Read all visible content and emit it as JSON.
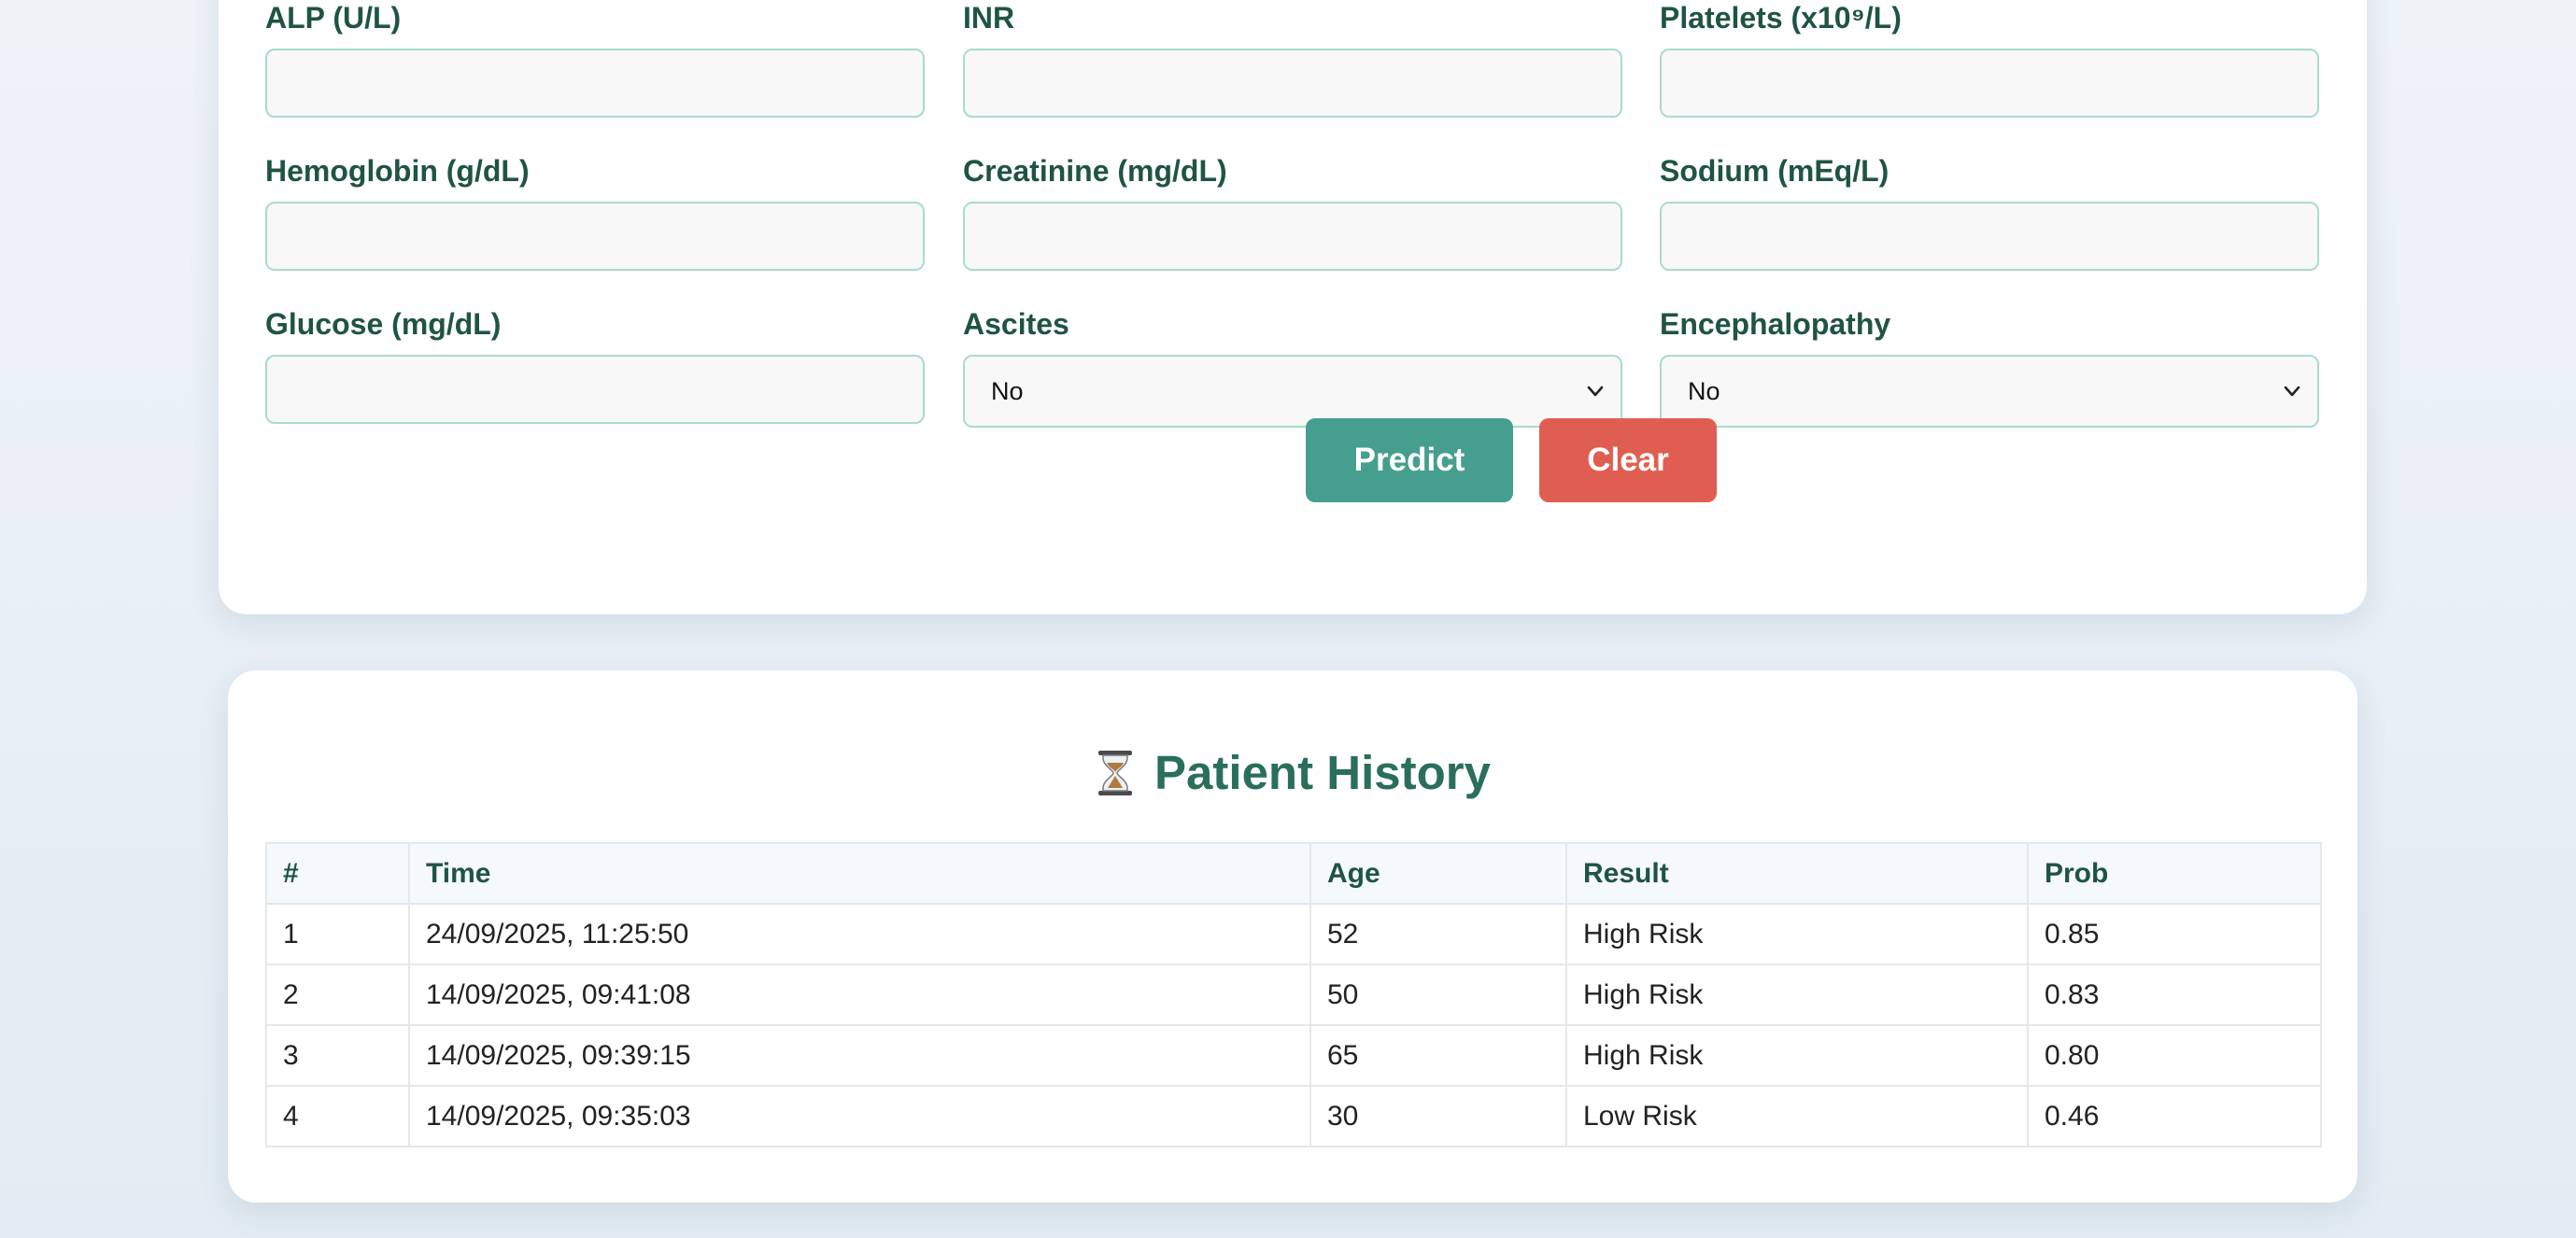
{
  "form": {
    "fields": [
      {
        "label": "ALP (U/L)",
        "value": ""
      },
      {
        "label": "INR",
        "value": ""
      },
      {
        "label": "Platelets (x10⁹/L)",
        "value": ""
      },
      {
        "label": "Hemoglobin (g/dL)",
        "value": ""
      },
      {
        "label": "Creatinine (mg/dL)",
        "value": ""
      },
      {
        "label": "Sodium (mEq/L)",
        "value": ""
      },
      {
        "label": "Glucose (mg/dL)",
        "value": ""
      }
    ],
    "selects": [
      {
        "label": "Ascites",
        "value": "No"
      },
      {
        "label": "Encephalopathy",
        "value": "No"
      }
    ],
    "predict_label": "Predict",
    "clear_label": "Clear"
  },
  "history": {
    "title": "Patient History",
    "icon": "hourglass-icon",
    "columns": [
      "#",
      "Time",
      "Age",
      "Result",
      "Prob"
    ],
    "rows": [
      {
        "num": "1",
        "time": "24/09/2025, 11:25:50",
        "age": "52",
        "result": "High Risk",
        "prob": "0.85"
      },
      {
        "num": "2",
        "time": "14/09/2025, 09:41:08",
        "age": "50",
        "result": "High Risk",
        "prob": "0.83"
      },
      {
        "num": "3",
        "time": "14/09/2025, 09:39:15",
        "age": "65",
        "result": "High Risk",
        "prob": "0.80"
      },
      {
        "num": "4",
        "time": "14/09/2025, 09:35:03",
        "age": "30",
        "result": "Low Risk",
        "prob": "0.46"
      }
    ]
  },
  "colors": {
    "label": "#1f5443",
    "title": "#2a6e5c",
    "predict": "#469f8e",
    "clear": "#e05e51",
    "high_risk": "#c62828",
    "low_risk": "#2e7d32"
  }
}
